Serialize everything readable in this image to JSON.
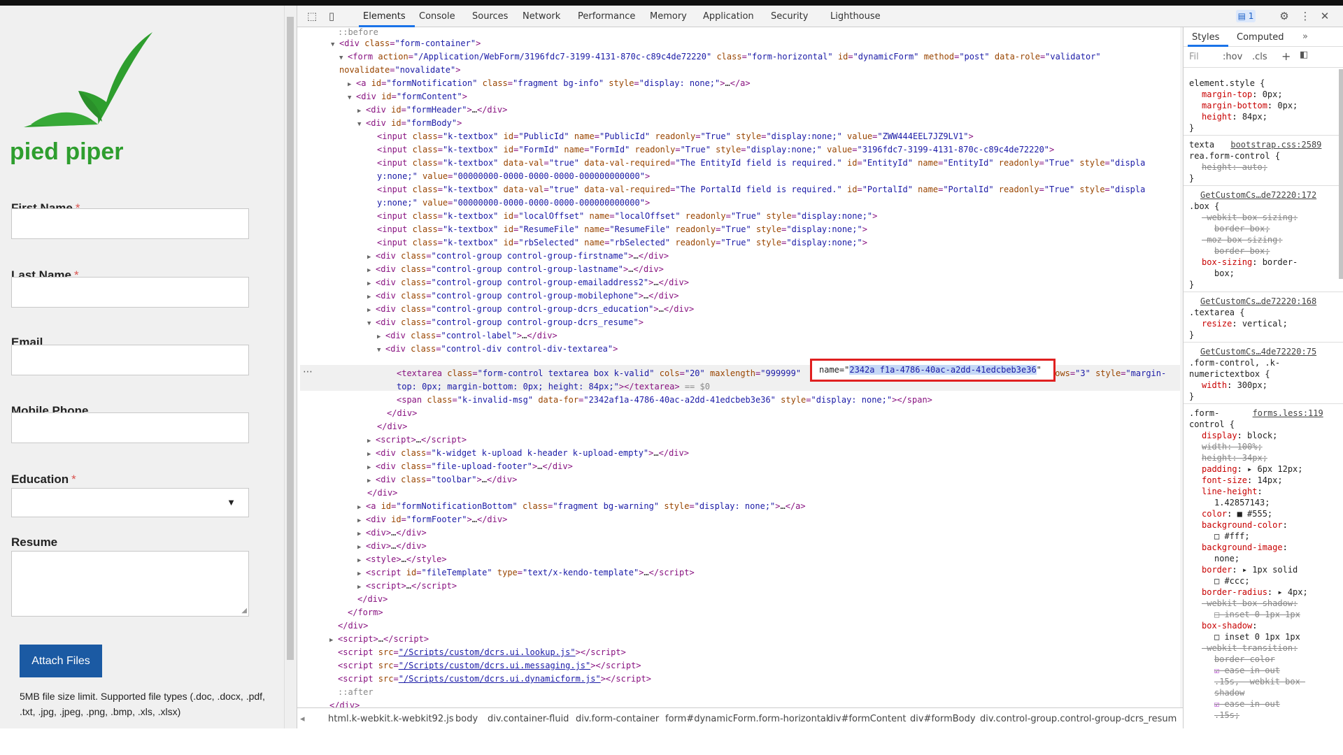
{
  "form": {
    "logo_text": "pied piper",
    "first_name_label": "First Name",
    "last_name_label": "Last Name",
    "email_label": "Email",
    "mobile_label": "Mobile Phone",
    "education_label": "Education",
    "resume_label": "Resume",
    "required_mark": "*",
    "education_caret": "▼",
    "attach_label": "Attach Files",
    "file_limit_text": "5MB file size limit. Supported file types (.doc, .docx, .pdf, .txt, .jpg, .jpeg, .png, .bmp, .xls, .xlsx)"
  },
  "devtools": {
    "tabs": [
      "Elements",
      "Console",
      "Sources",
      "Network",
      "Performance",
      "Memory",
      "Application",
      "Security",
      "Lighthouse"
    ],
    "message_count": "1",
    "icons": {
      "inspect": "inspect-icon",
      "device": "device-toggle-icon",
      "settings": "gear-icon",
      "more": "kebab-icon",
      "close": "close-icon"
    },
    "highlight": {
      "prefix": "name=\"",
      "selected": "2342a f1a-4786-40ac-a2dd-41edcbeb3e36",
      "suffix": "\""
    },
    "breadcrumbs": [
      "html.k-webkit.k-webkit92.js",
      "body",
      "div.container-fluid",
      "div.form-container",
      "form#dynamicForm.form-horizontal",
      "div#formContent",
      "div#formBody",
      "div.control-group.control-group-dcrs_resum"
    ],
    "styles_tabs": {
      "styles": "Styles",
      "computed": "Computed",
      "more": "»"
    },
    "filter": {
      "placeholder": "Filter",
      "hov": ":hov",
      "cls": ".cls",
      "plus": "+"
    }
  }
}
